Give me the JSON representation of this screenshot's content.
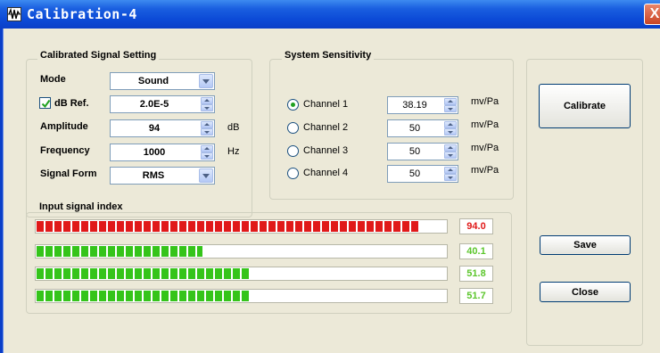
{
  "window": {
    "title": "Calibration-4",
    "close_glyph": "X"
  },
  "signal_setting": {
    "group_title": "Calibrated Signal Setting",
    "mode_label": "Mode",
    "mode_value": "Sound",
    "dbref_label": "dB Ref.",
    "dbref_checked": true,
    "dbref_value": "2.0E-5",
    "amplitude_label": "Amplitude",
    "amplitude_value": "94",
    "amplitude_unit": "dB",
    "frequency_label": "Frequency",
    "frequency_value": "1000",
    "frequency_unit": "Hz",
    "signal_form_label": "Signal Form",
    "signal_form_value": "RMS"
  },
  "sensitivity": {
    "group_title": "System Sensitivity",
    "channels": [
      {
        "label": "Channel 1",
        "value": "38.19",
        "unit": "mv/Pa",
        "selected": true
      },
      {
        "label": "Channel 2",
        "value": "50",
        "unit": "mv/Pa",
        "selected": false
      },
      {
        "label": "Channel 3",
        "value": "50",
        "unit": "mv/Pa",
        "selected": false
      },
      {
        "label": "Channel 4",
        "value": "50",
        "unit": "mv/Pa",
        "selected": false
      }
    ]
  },
  "input_index": {
    "group_title": "Input signal index",
    "bars": [
      {
        "value": "94.0",
        "fill_fraction": 0.935,
        "color": "#e01919",
        "text_color": "#e01919"
      },
      {
        "value": "40.1",
        "fill_fraction": 0.405,
        "color": "#35c41a",
        "text_color": "#5cc62c"
      },
      {
        "value": "51.8",
        "fill_fraction": 0.52,
        "color": "#35c41a",
        "text_color": "#5cc62c"
      },
      {
        "value": "51.7",
        "fill_fraction": 0.52,
        "color": "#35c41a",
        "text_color": "#5cc62c"
      }
    ]
  },
  "buttons": {
    "calibrate": "Calibrate",
    "save": "Save",
    "close": "Close"
  },
  "colors": {
    "title_bar": "#0a3fc8",
    "client_bg": "#ece9d8",
    "red_segment": "#e01919",
    "green_segment": "#35c41a"
  }
}
